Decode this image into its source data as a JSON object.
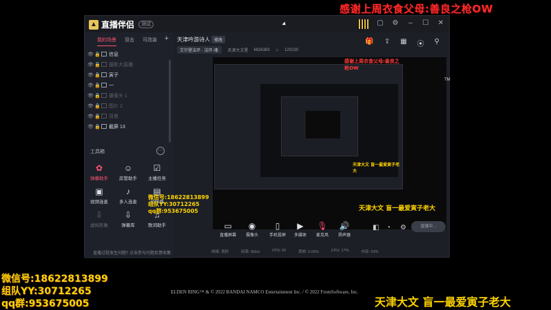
{
  "overlay": {
    "top_banner": "感谢上周衣食父母:善良之枪OW",
    "contact_lines": [
      "微信号:18622813899",
      "组队YY:30712265",
      "qq群:953675005"
    ],
    "bottom_banner": "天津大文 盲一最爱寅子老大",
    "game_credit": "ELDEN RING™ & © 2022 BANDAI NAMCO Entertainment Inc. / © 2022 FromSoftware, Inc."
  },
  "app": {
    "name": "直播伴侣",
    "badge": "测试",
    "window_controls": [
      "☐",
      "–",
      "☐",
      "✕"
    ],
    "tabs": [
      {
        "label": "我的场景",
        "active": true
      },
      {
        "label": "双击",
        "active": false
      },
      {
        "label": "可改装",
        "active": false
      }
    ],
    "scenes": [
      {
        "label": "信息",
        "dim": false
      },
      {
        "label": "摄影大直播",
        "dim": true
      },
      {
        "label": "寅子",
        "dim": false
      },
      {
        "label": "一",
        "dim": false
      },
      {
        "label": "摄像头 1",
        "dim": true
      },
      {
        "label": "图片 2",
        "dim": true
      },
      {
        "label": "背景",
        "dim": true
      },
      {
        "label": "截屏 13",
        "dim": false
      }
    ],
    "tools_header": "工具箱",
    "tools": [
      {
        "label": "弹幕助手",
        "icon": "gear-icon",
        "state": "hot"
      },
      {
        "label": "房管助手",
        "icon": "user-icon",
        "state": ""
      },
      {
        "label": "主播任务",
        "icon": "check-icon",
        "state": ""
      },
      {
        "label": "视频连麦",
        "icon": "video-icon",
        "state": ""
      },
      {
        "label": "多人连麦",
        "icon": "mic-icon",
        "state": ""
      },
      {
        "label": "设弹幕",
        "icon": "chat-icon",
        "state": ""
      },
      {
        "label": "虚拟形象",
        "icon": "download-icon",
        "state": "dim"
      },
      {
        "label": "弹幕库",
        "icon": "download-icon",
        "state": ""
      },
      {
        "label": "歌词助手",
        "icon": "music-icon",
        "state": ""
      }
    ],
    "notice": "直播过程发生问题? 点击参与问题反馈收集",
    "stream_title": "天津吟游诗人",
    "edit_label": "修改",
    "meta": {
      "tag": "艾尔登法环 · 法环·魂·",
      "category": "天津大文星",
      "room_id": "6826383",
      "hot": "120230"
    },
    "bottom_buttons": [
      {
        "label": "直播屏幕",
        "icon": "monitor-icon"
      },
      {
        "label": "摄像头",
        "icon": "camera-icon"
      },
      {
        "label": "手机投屏",
        "icon": "phone-icon"
      },
      {
        "label": "多媒体",
        "icon": "media-icon"
      },
      {
        "label": "麦克风",
        "icon": "mic-icon"
      },
      {
        "label": "扬声器",
        "icon": "speaker-icon"
      }
    ],
    "start_label": "直播中...",
    "status": [
      "网络: 良好",
      "码率: 0kb/s",
      "FPS: 60",
      "丢帧: 0.00%",
      "CPU: 17%",
      "内存: 53%"
    ],
    "tm_mark": "TM",
    "preview_credit": "ELDEN RING™ & © 2022 BANDAI NAMCO Entertainment Inc. / © 2022 FromSoftware, Inc."
  }
}
